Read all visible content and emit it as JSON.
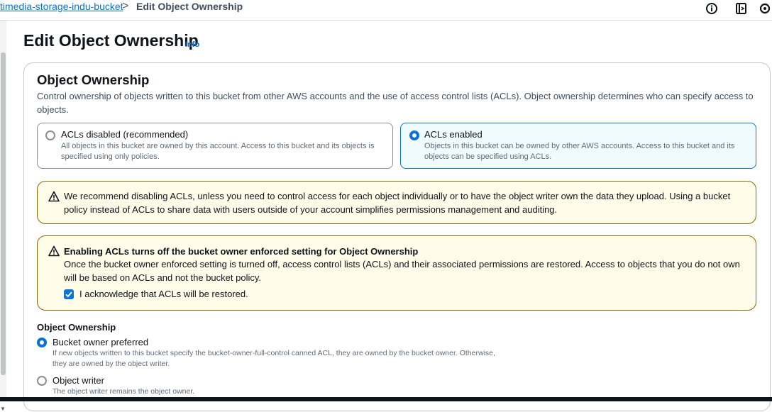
{
  "breadcrumb": {
    "bucket": "timedia-storage-indu-bucket",
    "separator": ">",
    "current": "Edit Object Ownership"
  },
  "top_icons": [
    "info-circle-icon",
    "terminal-panel-icon",
    "settings-icon"
  ],
  "page": {
    "title": "Edit Object Ownership",
    "info": "Info"
  },
  "section": {
    "title": "Object Ownership",
    "description": "Control ownership of objects written to this bucket from other AWS accounts and the use of access control lists (ACLs). Object ownership determines who can specify access to objects."
  },
  "tiles": [
    {
      "label": "ACLs disabled (recommended)",
      "description": "All objects in this bucket are owned by this account. Access to this bucket and its objects is specified using only policies.",
      "selected": false
    },
    {
      "label": "ACLs enabled",
      "description": "Objects in this bucket can be owned by other AWS accounts. Access to this bucket and its objects can be specified using ACLs.",
      "selected": true
    }
  ],
  "alert1": {
    "text": "We recommend disabling ACLs, unless you need to control access for each object individually or to have the object writer own the data they upload. Using a bucket policy instead of ACLs to share data with users outside of your account simplifies permissions management and auditing."
  },
  "alert2": {
    "title": "Enabling ACLs turns off the bucket owner enforced setting for Object Ownership",
    "text": "Once the bucket owner enforced setting is turned off, access control lists (ACLs) and their associated permissions are restored. Access to objects that you do not own will be based on ACLs and not the bucket policy.",
    "checkbox_label": "I acknowledge that ACLs will be restored.",
    "checked": true
  },
  "ownership": {
    "label": "Object Ownership",
    "options": [
      {
        "label": "Bucket owner preferred",
        "description": "If new objects written to this bucket specify the bucket-owner-full-control canned ACL, they are owned by the bucket owner. Otherwise, they are owned by the object writer.",
        "selected": true
      },
      {
        "label": "Object writer",
        "description": "The object writer remains the object owner.",
        "selected": false
      }
    ]
  },
  "colors": {
    "link": "#0972d3",
    "warning_border": "#8d6605",
    "warning_bg": "#fffce9",
    "selected_tile_bg": "#f0fbff"
  }
}
